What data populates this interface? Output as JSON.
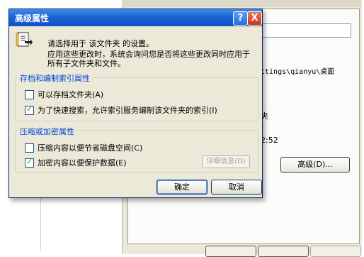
{
  "background": {
    "path_text": "ttings\\qianyu\\桌面",
    "partial_char": "夹",
    "time_text": "2:52",
    "advanced_button": "高级(D)..."
  },
  "dialog": {
    "title": "高级属性",
    "help_button": "?",
    "close_button": "X",
    "info_lines": [
      "请选择用于 该文件夹 的设置。",
      "应用这些更改时，系统会询问您是否将这些更改同时应用于",
      "所有子文件夹和文件。"
    ],
    "archive_group": {
      "label": "存档和编制索引属性",
      "options": [
        {
          "label": "可以存档文件夹(A)",
          "checked": false
        },
        {
          "label": "为了快速搜索，允许索引服务编制该文件夹的索引(I)",
          "checked": true
        }
      ]
    },
    "compress_group": {
      "label": "压缩或加密属性",
      "options": [
        {
          "label": "压缩内容以便节省磁盘空间(C)",
          "checked": false
        },
        {
          "label": "加密内容以便保护数据(E)",
          "checked": true
        }
      ],
      "details_button": "详细信息(D)"
    },
    "ok_button": "确定",
    "cancel_button": "取消"
  },
  "colors": {
    "title_bar": "#1b62d6",
    "group_label": "#0046d5",
    "dialog_bg": "#ece9d8"
  }
}
